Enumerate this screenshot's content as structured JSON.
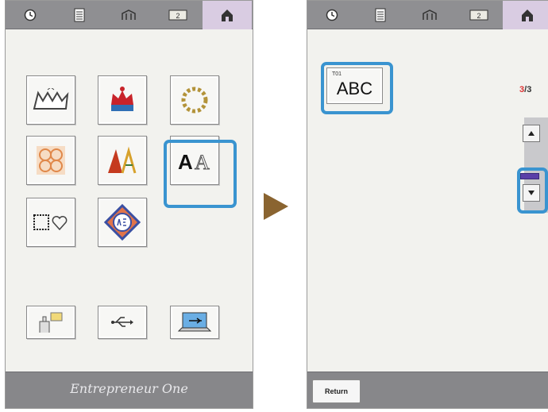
{
  "left": {
    "topbar": [
      "clock-icon",
      "document-icon",
      "embroidery-icon",
      "page-icon",
      "home-icon"
    ],
    "active_tab": 4,
    "brand": "Entrepreneur One",
    "categories": [
      "design-king",
      "design-crown",
      "design-wreath",
      "design-quilt",
      "design-letters",
      "design-font",
      "design-frame",
      "design-monogram"
    ]
  },
  "right": {
    "item_code": "T01",
    "item_text": "ABC",
    "page_current": "3",
    "page_total": "3",
    "return_label": "Return"
  },
  "colors": {
    "highlight": "#3a94d0",
    "arrow": "#8a6430",
    "topbar": "#8f8f92",
    "active_tab": "#d9cce2"
  }
}
